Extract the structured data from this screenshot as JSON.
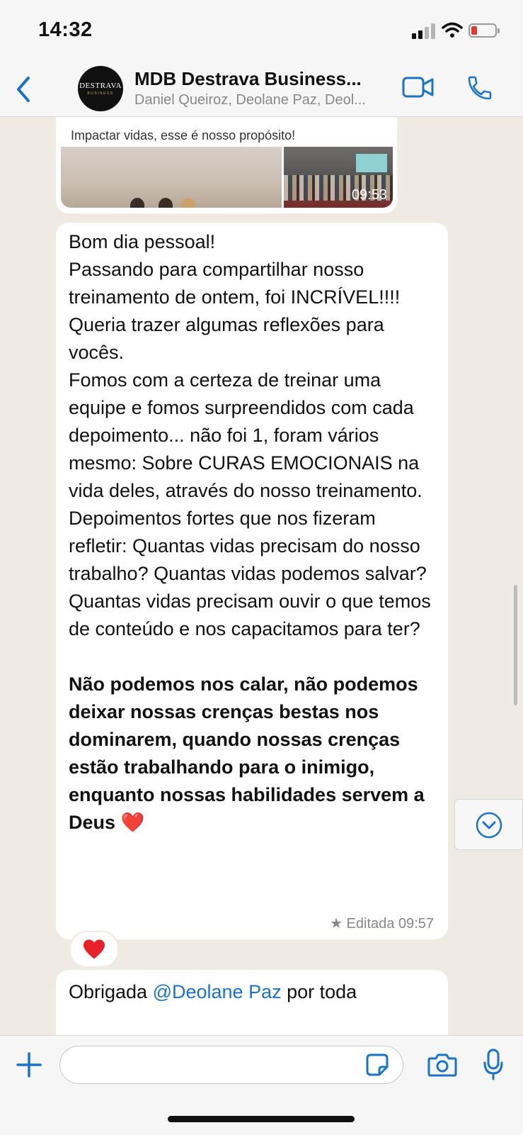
{
  "status_bar": {
    "time": "14:32"
  },
  "header": {
    "title": "MDB Destrava Business...",
    "subtitle": "Daniel Queiroz, Deolane Paz, Deol...",
    "avatar_text": "DESTRAVA",
    "avatar_subtext": "BUSINESS"
  },
  "messages": {
    "prev": {
      "caption": "Impactar vidas, esse é nosso propósito!",
      "video_time": "09:53"
    },
    "main": {
      "lines": [
        "Bom dia pessoal!",
        "Passando para compartilhar nosso treinamento de ontem, foi INCRÍVEL!!!!",
        "Queria trazer algumas reflexões para vocês.",
        "Fomos com a certeza de treinar uma equipe e fomos surpreendidos com cada depoimento... não foi 1, foram vários mesmo: Sobre CURAS EMOCIONAIS na vida deles, através do nosso treinamento. Depoimentos fortes que nos fizeram refletir: Quantas vidas precisam do nosso trabalho? Quantas vidas podemos salvar? Quantas vidas precisam ouvir o que temos de conteúdo e nos capacitamos para ter?"
      ],
      "bold": "Não podemos nos calar, não podemos deixar nossas crenças bestas nos dominarem, quando nossas crenças estão trabalhando para o inimigo, enquanto nossas habilidades servem a Deus ❤️",
      "meta": "★ Editada 09:57",
      "reaction": "❤️"
    },
    "next": {
      "text_before": "Obrigada ",
      "mention": "@Deolane Paz",
      "text_after": "  por toda"
    }
  },
  "colors": {
    "accent": "#1a73c9",
    "bubble": "#ffffff",
    "background": "#efeae2",
    "bar": "#f6f6f6"
  },
  "icons": [
    "back-chevron-icon",
    "video-call-icon",
    "phone-icon",
    "plus-icon",
    "sticker-icon",
    "camera-icon",
    "microphone-icon",
    "chevron-down-icon"
  ]
}
